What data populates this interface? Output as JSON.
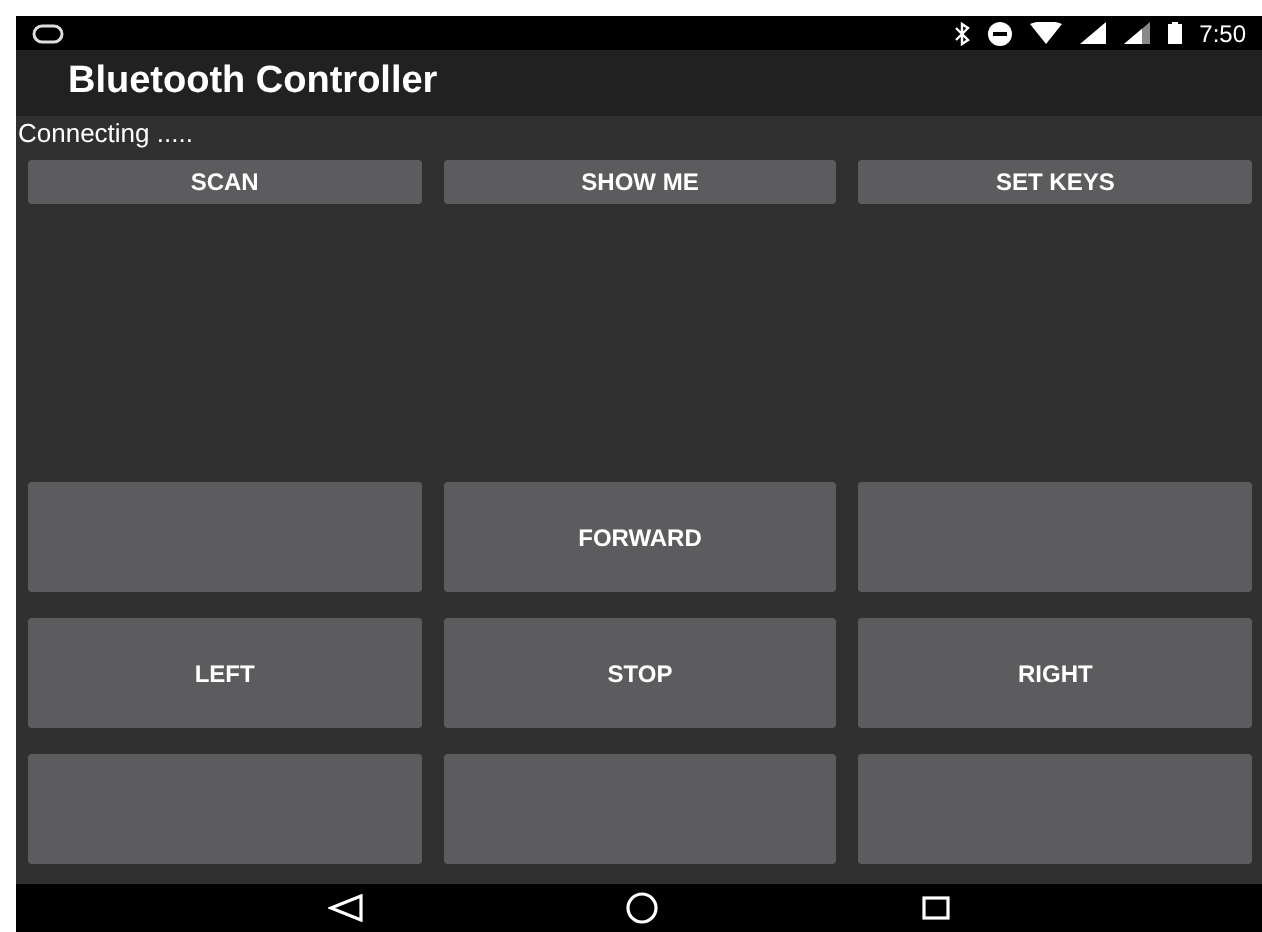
{
  "status_bar": {
    "time": "7:50"
  },
  "app_bar": {
    "title": "Bluetooth Controller"
  },
  "status_text": "Connecting .....",
  "top_buttons": [
    "SCAN",
    "SHOW ME",
    "SET KEYS"
  ],
  "pad_rows": [
    [
      {
        "kind": "blank"
      },
      {
        "kind": "labeled",
        "label": "FORWARD"
      },
      {
        "kind": "blank"
      }
    ],
    [
      {
        "kind": "labeled",
        "label": "LEFT"
      },
      {
        "kind": "labeled",
        "label": "STOP"
      },
      {
        "kind": "labeled",
        "label": "RIGHT"
      }
    ],
    [
      {
        "kind": "blank"
      },
      {
        "kind": "blank"
      },
      {
        "kind": "blank"
      }
    ]
  ]
}
